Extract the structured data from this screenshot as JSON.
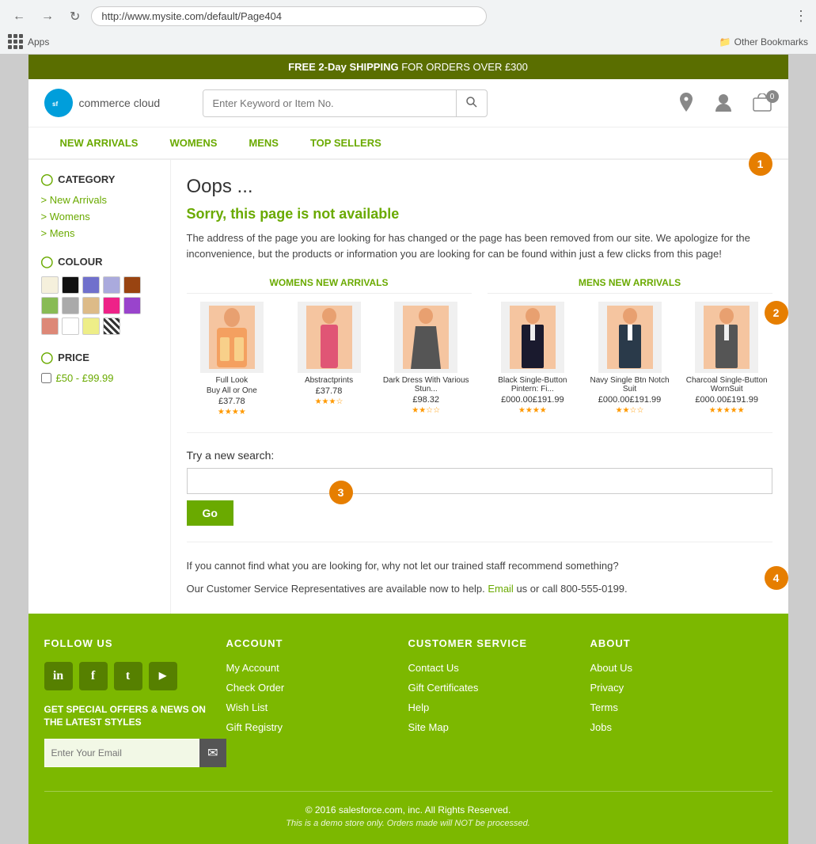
{
  "browser": {
    "url": "http://www.mysite.com/default/Page404",
    "apps_label": "Apps",
    "other_bookmarks": "Other Bookmarks"
  },
  "promo": {
    "text_bold": "FREE 2-Day SHIPPING",
    "text_rest": " FOR ORDERS OVER £300"
  },
  "header": {
    "logo_initials": "sf",
    "logo_text": "commerce cloud",
    "search_placeholder": "Enter Keyword or Item No.",
    "cart_count": "0"
  },
  "nav": {
    "items": [
      "NEW ARRIVALS",
      "WOMENS",
      "MENS",
      "TOP SELLERS"
    ]
  },
  "sidebar": {
    "category_title": "CATEGORY",
    "category_links": [
      "New Arrivals",
      "Womens",
      "Mens"
    ],
    "colour_title": "COLOUR",
    "swatches": [
      {
        "color": "#f5f0dc",
        "name": "cream"
      },
      {
        "color": "#111111",
        "name": "black"
      },
      {
        "color": "#7070cc",
        "name": "blue-purple"
      },
      {
        "color": "#aaaadd",
        "name": "light-blue"
      },
      {
        "color": "#994411",
        "name": "brown"
      },
      {
        "color": "#88bb55",
        "name": "green"
      },
      {
        "color": "#aaaaaa",
        "name": "grey"
      },
      {
        "color": "#ddbb88",
        "name": "tan"
      },
      {
        "color": "#ee2288",
        "name": "pink"
      },
      {
        "color": "#9944cc",
        "name": "purple"
      },
      {
        "color": "#dd8877",
        "name": "peach"
      },
      {
        "color": "#ffffff",
        "name": "white"
      },
      {
        "color": "#eeee88",
        "name": "yellow"
      },
      {
        "color": "pattern",
        "name": "pattern"
      }
    ],
    "price_title": "PRICE",
    "price_range": "£50 - £99.99"
  },
  "error": {
    "title": "Oops ...",
    "subtitle": "Sorry, this page is not available",
    "description": "The address of the page you are looking for has changed or the page has been removed from our site.  We apologize for the inconvenience, but the products or information you are looking for can be found within just a few clicks from this page!"
  },
  "womens_section": {
    "title": "WOMENS NEW ARRIVALS",
    "products": [
      {
        "name": "Full Look",
        "subname": "Buy All or One",
        "price": "£37.78",
        "stars": "★★★★"
      },
      {
        "name": "Abstractprints",
        "subname": "",
        "price": "£37.78",
        "stars": "★★★☆"
      },
      {
        "name": "Dark Dress With Various Stun...",
        "subname": "",
        "price": "£98.32",
        "stars": "★★☆☆"
      }
    ]
  },
  "mens_section": {
    "title": "MENS NEW ARRIVALS",
    "products": [
      {
        "name": "Black Single-Button Pintern: Fi...",
        "subname": "",
        "price": "£000.00£191.99",
        "stars": "★★★★"
      },
      {
        "name": "Navy Single Btn Notch Suit",
        "subname": "",
        "price": "£000.00£191.99",
        "stars": "★★☆☆"
      },
      {
        "name": "Charcoal Single-Button WornSuit",
        "subname": "",
        "price": "£000.00£191.99",
        "stars": "★★★★★"
      }
    ]
  },
  "search": {
    "label": "Try a new search:",
    "placeholder": "",
    "go_btn": "Go"
  },
  "customer_service": {
    "text1": "If you cannot find what you are looking for, why not let our trained staff recommend something?",
    "text2_pre": "Our Customer Service Representatives are available now to help.",
    "email_link": "Email",
    "text2_post": "us or call 800-555-0199."
  },
  "footer": {
    "follow_title": "FOLLOW US",
    "social": [
      {
        "icon": "in",
        "name": "linkedin"
      },
      {
        "icon": "f",
        "name": "facebook"
      },
      {
        "icon": "t",
        "name": "twitter"
      },
      {
        "icon": "▶",
        "name": "youtube"
      }
    ],
    "newsletter_tagline": "GET SPECIAL OFFERS & NEWS ON THE LATEST STYLES",
    "email_placeholder": "Enter Your Email",
    "account_title": "ACCOUNT",
    "account_links": [
      "My Account",
      "Check Order",
      "Wish List",
      "Gift Registry"
    ],
    "customer_service_title": "CUSTOMER SERVICE",
    "cs_links": [
      "Contact Us",
      "Gift Certificates",
      "Help",
      "Site Map"
    ],
    "about_title": "ABOUT",
    "about_links": [
      "About Us",
      "Privacy",
      "Terms",
      "Jobs"
    ],
    "copyright": "© 2016 salesforce.com, inc. All Rights Reserved.",
    "disclaimer": "This is a demo store only. Orders made will NOT be processed."
  },
  "annotations": {
    "1": "1",
    "2": "2",
    "3": "3",
    "4": "4"
  }
}
